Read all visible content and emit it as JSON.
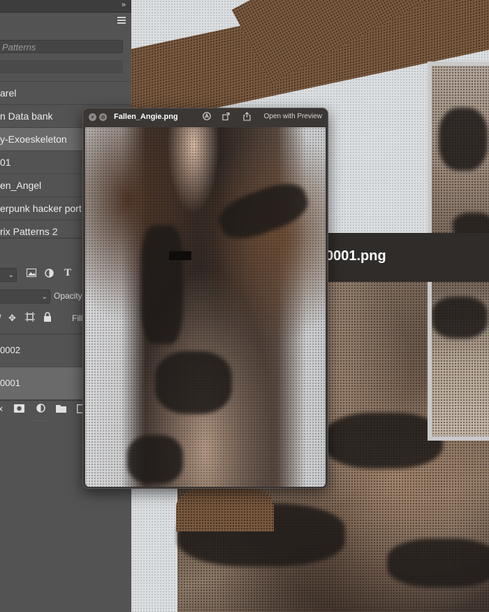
{
  "panel": {
    "collapse_glyph": "»",
    "search_placeholder": "Patterns",
    "libraries": [
      {
        "label": "arel",
        "selected": false
      },
      {
        "label": "n Data bank",
        "selected": false
      },
      {
        "label": "y-Exoeskeleton",
        "selected": true
      },
      {
        "label": "01",
        "selected": false
      },
      {
        "label": "en_Angel",
        "selected": false
      },
      {
        "label": "erpunk hacker port",
        "selected": false
      },
      {
        "label": "rix Patterns 2",
        "selected": false
      }
    ],
    "opacity_label": "Opacity",
    "fill_label": "Fill",
    "layers": [
      {
        "label": "0002",
        "selected": false
      },
      {
        "label": "0001",
        "selected": true
      }
    ]
  },
  "canvas": {
    "filename_fragment": "0001.png"
  },
  "quicklook": {
    "title": "Fallen_Angie.png",
    "open_with": "Open with Preview",
    "close_glyph": "×",
    "fullscreen_glyph": "⊘"
  },
  "colors": {
    "panel_bg": "#535353",
    "selected_row": "#6a6a6a",
    "quicklook_bar": "#3b3735"
  }
}
